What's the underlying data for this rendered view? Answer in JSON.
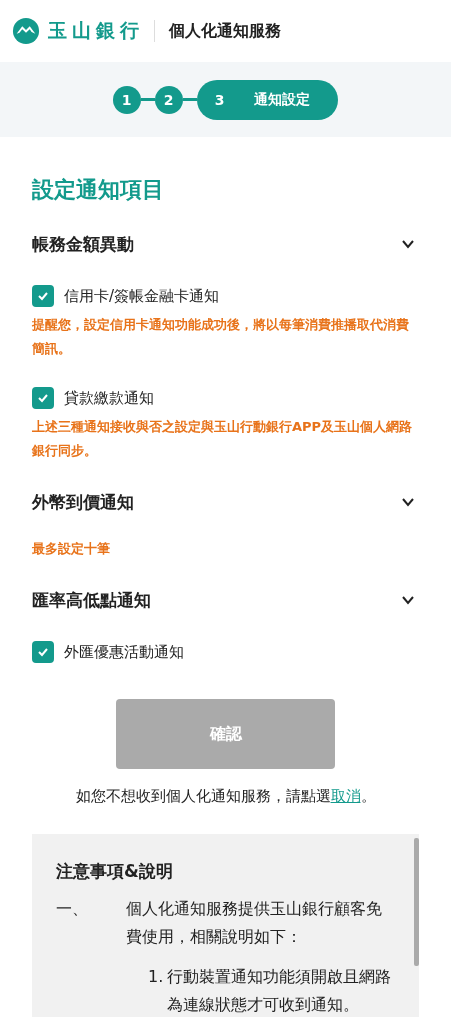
{
  "header": {
    "brand": "玉山銀行",
    "title": "個人化通知服務"
  },
  "steps": [
    {
      "number": "1",
      "selected": false
    },
    {
      "number": "2",
      "selected": false
    },
    {
      "number": "3",
      "label": "通知設定",
      "selected": true
    }
  ],
  "page_title": "設定通知項目",
  "items": [
    {
      "kind": "section",
      "title": "帳務金額異動",
      "expanded": false
    },
    {
      "kind": "checkbox",
      "label": "信用卡/簽帳金融卡通知",
      "checked": true
    },
    {
      "kind": "note",
      "text": "提醒您，設定信用卡通知功能成功後，將以每筆消費推播取代消費簡訊。"
    },
    {
      "kind": "checkbox",
      "label": "貸款繳款通知",
      "checked": true
    },
    {
      "kind": "note",
      "text": "上述三種通知接收與否之設定與玉山行動銀行APP及玉山個人網路銀行同步。"
    },
    {
      "kind": "section",
      "title": "外幣到價通知",
      "expanded": false
    },
    {
      "kind": "note",
      "text": "最多設定十筆"
    },
    {
      "kind": "section",
      "title": "匯率高低點通知",
      "expanded": false
    },
    {
      "kind": "checkbox",
      "label": "外匯優惠活動通知",
      "checked": true
    }
  ],
  "confirm_button": {
    "label": "確認",
    "disabled": true
  },
  "cancel_line": {
    "text": "如您不想收到個人化通知服務，請點選",
    "link": "取消",
    "end": "。"
  },
  "notice": {
    "title": "注意事項&說明",
    "entries": [
      {
        "marker": "一、",
        "text": "個人化通知服務提供玉山銀行顧客免費使用，相關說明如下：",
        "children": [
          {
            "marker": "1.",
            "text": "行動裝置通知功能須開啟且網路為連線狀態才可收到通知。"
          }
        ]
      }
    ]
  }
}
